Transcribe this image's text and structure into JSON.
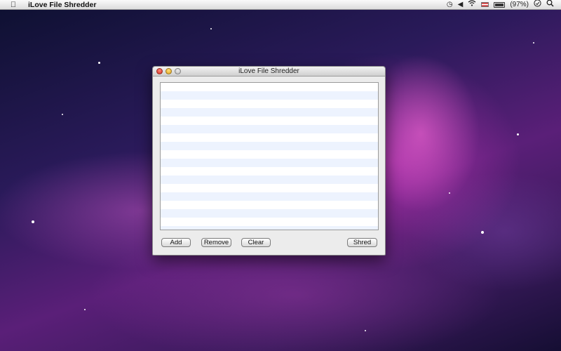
{
  "menubar": {
    "app_name": "iLove File Shredder",
    "battery_text": "(97%)",
    "icons": [
      "apple-icon",
      "time-machine-icon",
      "volume-icon",
      "wifi-icon",
      "input-flag-icon",
      "battery-icon",
      "clock-icon",
      "spotlight-icon"
    ]
  },
  "window": {
    "title": "iLove File Shredder",
    "buttons": {
      "add": "Add",
      "remove": "Remove",
      "clear": "Clear",
      "shred": "Shred"
    }
  },
  "colors": {
    "list_stripe": "#edf3fe",
    "close": "#d3261b",
    "minimize": "#e0a018",
    "zoom": "#b8b8b8"
  }
}
